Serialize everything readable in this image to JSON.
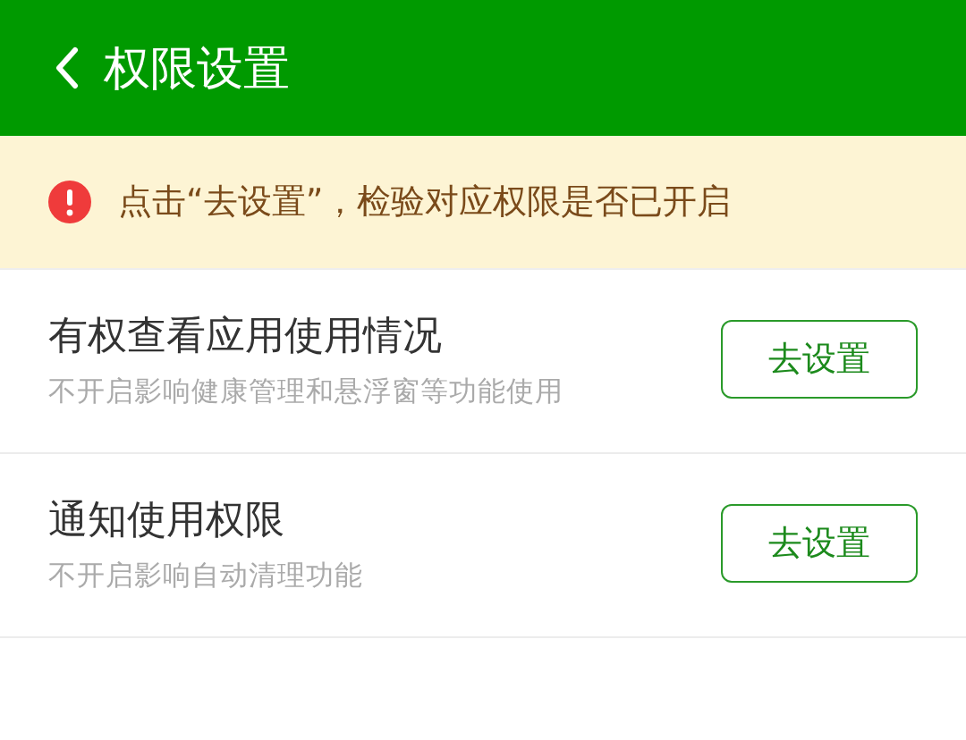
{
  "header": {
    "title": "权限设置"
  },
  "notice": {
    "text": "点击“去设置”，检验对应权限是否已开启"
  },
  "permissions": [
    {
      "title": "有权查看应用使用情况",
      "description": "不开启影响健康管理和悬浮窗等功能使用",
      "button": "去设置"
    },
    {
      "title": "通知使用权限",
      "description": "不开启影响自动清理功能",
      "button": "去设置"
    }
  ]
}
